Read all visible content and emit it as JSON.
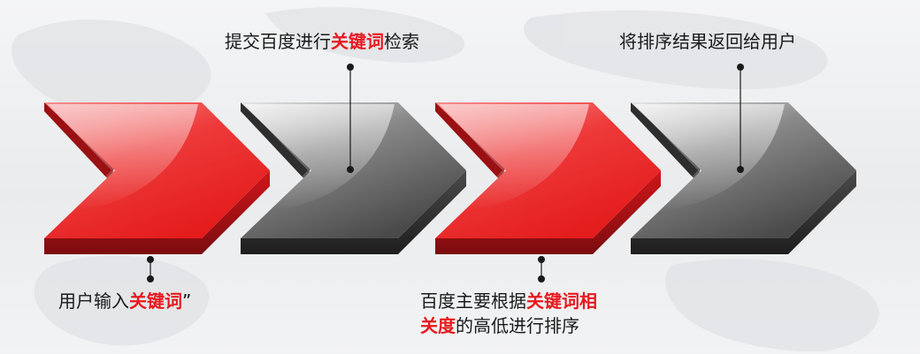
{
  "colors": {
    "red": "#e8191f",
    "red_light": "#f7a0a0",
    "red_dark": "#8e0f12",
    "gray": "#5a5a5a",
    "gray_light": "#d9d9d9",
    "gray_dark": "#2a2a2a",
    "text": "#1a1a1a",
    "highlight": "#e8191f"
  },
  "steps": [
    {
      "position": "below",
      "color": "red",
      "label": {
        "pre": "用户输入",
        "highlight": "关键词",
        "post": "”"
      }
    },
    {
      "position": "above",
      "color": "gray",
      "label": {
        "pre": "提交百度进行",
        "highlight": "关键词",
        "post": "检索"
      }
    },
    {
      "position": "below",
      "color": "red",
      "label": {
        "pre": "百度主要根据",
        "highlight": "关键词相",
        "post": ""
      },
      "label_line2": {
        "highlight": "关度",
        "post": "的高低进行排序"
      }
    },
    {
      "position": "above",
      "color": "gray",
      "label": {
        "pre": "将排序结果返回给用户",
        "highlight": "",
        "post": ""
      }
    }
  ]
}
